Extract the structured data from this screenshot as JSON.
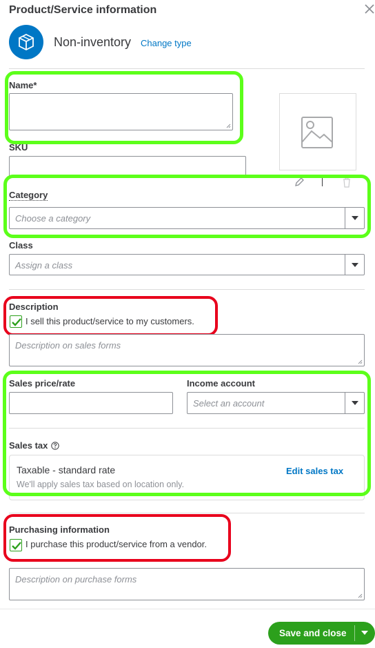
{
  "header": {
    "title": "Product/Service information",
    "close_icon": "close-icon"
  },
  "item_type": {
    "icon": "box-icon",
    "label": "Non-inventory",
    "change_link": "Change type"
  },
  "fields": {
    "name": {
      "label": "Name*",
      "value": ""
    },
    "sku": {
      "label": "SKU",
      "value": ""
    },
    "category": {
      "label": "Category",
      "placeholder": "Choose a category"
    },
    "class": {
      "label": "Class",
      "placeholder": "Assign a class"
    }
  },
  "image": {
    "placeholder_icon": "image-icon",
    "edit_icon": "pencil-icon",
    "delete_icon": "trash-icon"
  },
  "sales": {
    "section_label": "Description",
    "checkbox_label": "I sell this product/service to my customers.",
    "checked": true,
    "description_placeholder": "Description on sales forms",
    "price_label": "Sales price/rate",
    "price_value": "",
    "income_label": "Income account",
    "income_placeholder": "Select an account",
    "tax_label": "Sales tax",
    "tax_name": "Taxable - standard rate",
    "tax_note": "We'll apply sales tax based on location only.",
    "edit_tax": "Edit sales tax"
  },
  "purchasing": {
    "section_label": "Purchasing information",
    "checkbox_label": "I purchase this product/service from a vendor.",
    "checked": true,
    "description_placeholder": "Description on purchase forms"
  },
  "footer": {
    "save_label": "Save and close"
  },
  "colors": {
    "accent": "#0077c5",
    "primary_button": "#2ca01c",
    "highlight_green": "#5cff1a",
    "highlight_red": "#e8001c"
  }
}
